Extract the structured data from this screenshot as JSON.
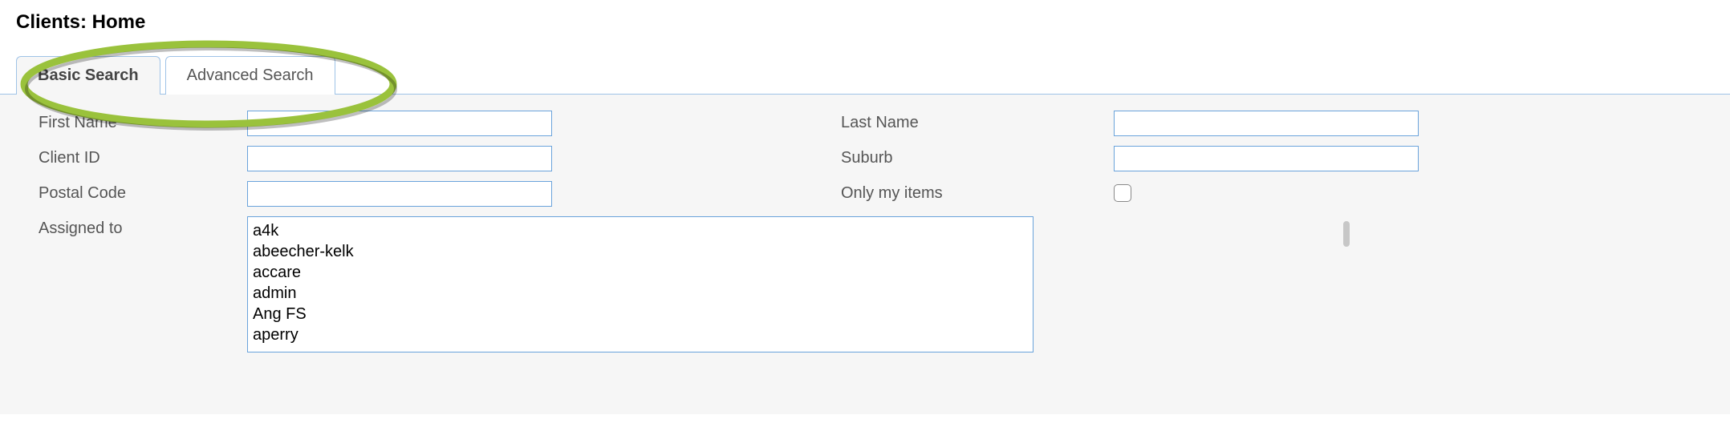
{
  "page_title": "Clients: Home",
  "tabs": {
    "basic": "Basic Search",
    "advanced": "Advanced Search"
  },
  "labels": {
    "first_name": "First Name",
    "last_name": "Last Name",
    "client_id": "Client ID",
    "suburb": "Suburb",
    "postal_code": "Postal Code",
    "only_my_items": "Only my items",
    "assigned_to": "Assigned to"
  },
  "values": {
    "first_name": "",
    "last_name": "",
    "client_id": "",
    "suburb": "",
    "postal_code": "",
    "only_my_items_checked": false
  },
  "assigned_options": [
    "a4k",
    "abeecher-kelk",
    "accare",
    "admin",
    "Ang FS",
    "aperry"
  ]
}
